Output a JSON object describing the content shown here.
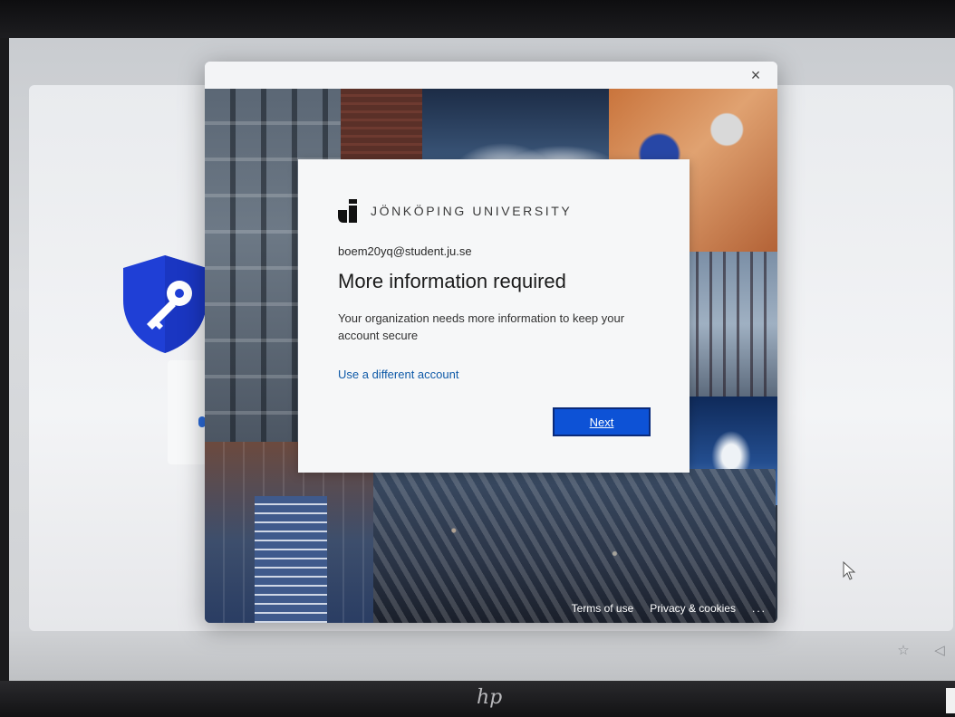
{
  "dialog": {
    "close_label": "×",
    "card": {
      "brand_name": "JÖNKÖPING UNIVERSITY",
      "email": "boem20yq@student.ju.se",
      "title": "More information required",
      "description": "Your organization needs more information to keep your account secure",
      "use_different_account": "Use a different account",
      "next_label": "Next"
    },
    "footer": {
      "terms": "Terms of use",
      "privacy": "Privacy & cookies",
      "more": "..."
    }
  },
  "colors": {
    "accent": "#0d52d6",
    "link": "#0f5aa8",
    "shield": "#1f3fd6"
  },
  "icons": {
    "shield": "shield-key-icon",
    "close": "close-icon",
    "cursor": "mouse-pointer-icon"
  },
  "bezel": {
    "brand": "hp"
  }
}
